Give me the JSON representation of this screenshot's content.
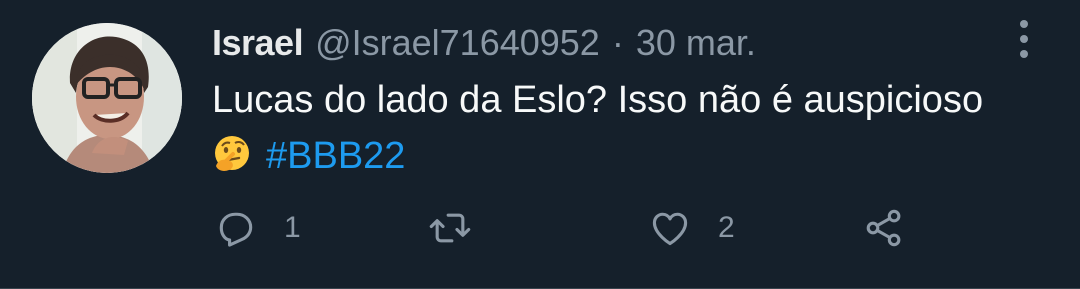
{
  "tweet": {
    "author": {
      "display_name": "Israel",
      "handle": "@Israel71640952"
    },
    "separator": "·",
    "timestamp": "30 mar.",
    "text": "Lucas do lado da Eslo? Isso não é auspicioso",
    "emoji": "thinking-face",
    "hashtag": "#BBB22",
    "reply_count": "1",
    "retweet_count": "",
    "like_count": "2"
  },
  "colors": {
    "background": "#15202b",
    "text": "#f7f9f9",
    "muted": "#8b98a5",
    "link": "#1d9bf0"
  },
  "icons": {
    "more": "more-vertical-icon",
    "reply": "reply-icon",
    "retweet": "retweet-icon",
    "like": "heart-icon",
    "share": "share-icon"
  }
}
